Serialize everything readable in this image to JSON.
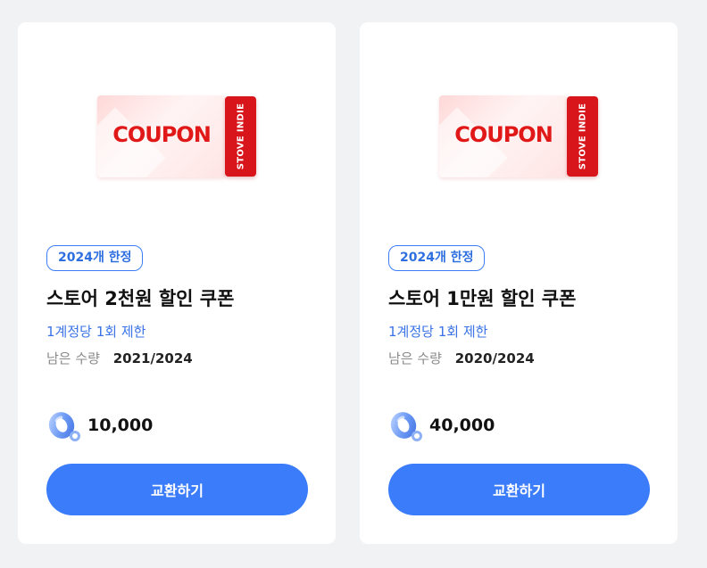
{
  "cards": [
    {
      "coupon_word": "COUPON",
      "coupon_brand": "STOVE INDIE",
      "limit_badge": "2024개 한정",
      "title": "스토어 2천원 할인 쿠폰",
      "account_limit": "1계정당 1회 제한",
      "remaining_label": "남은 수량",
      "remaining_value": "2021/2024",
      "price": "10,000",
      "price_icon": "coin-icon",
      "button_label": "교환하기"
    },
    {
      "coupon_word": "COUPON",
      "coupon_brand": "STOVE INDIE",
      "limit_badge": "2024개 한정",
      "title": "스토어 1만원 할인 쿠폰",
      "account_limit": "1계정당 1회 제한",
      "remaining_label": "남은 수량",
      "remaining_value": "2020/2024",
      "price": "40,000",
      "price_icon": "coin-icon",
      "button_label": "교환하기"
    }
  ],
  "colors": {
    "accent": "#3b7cfa",
    "badge_text": "#2e6fe0",
    "coupon_red": "#d7151b",
    "background": "#f1f2f4"
  }
}
